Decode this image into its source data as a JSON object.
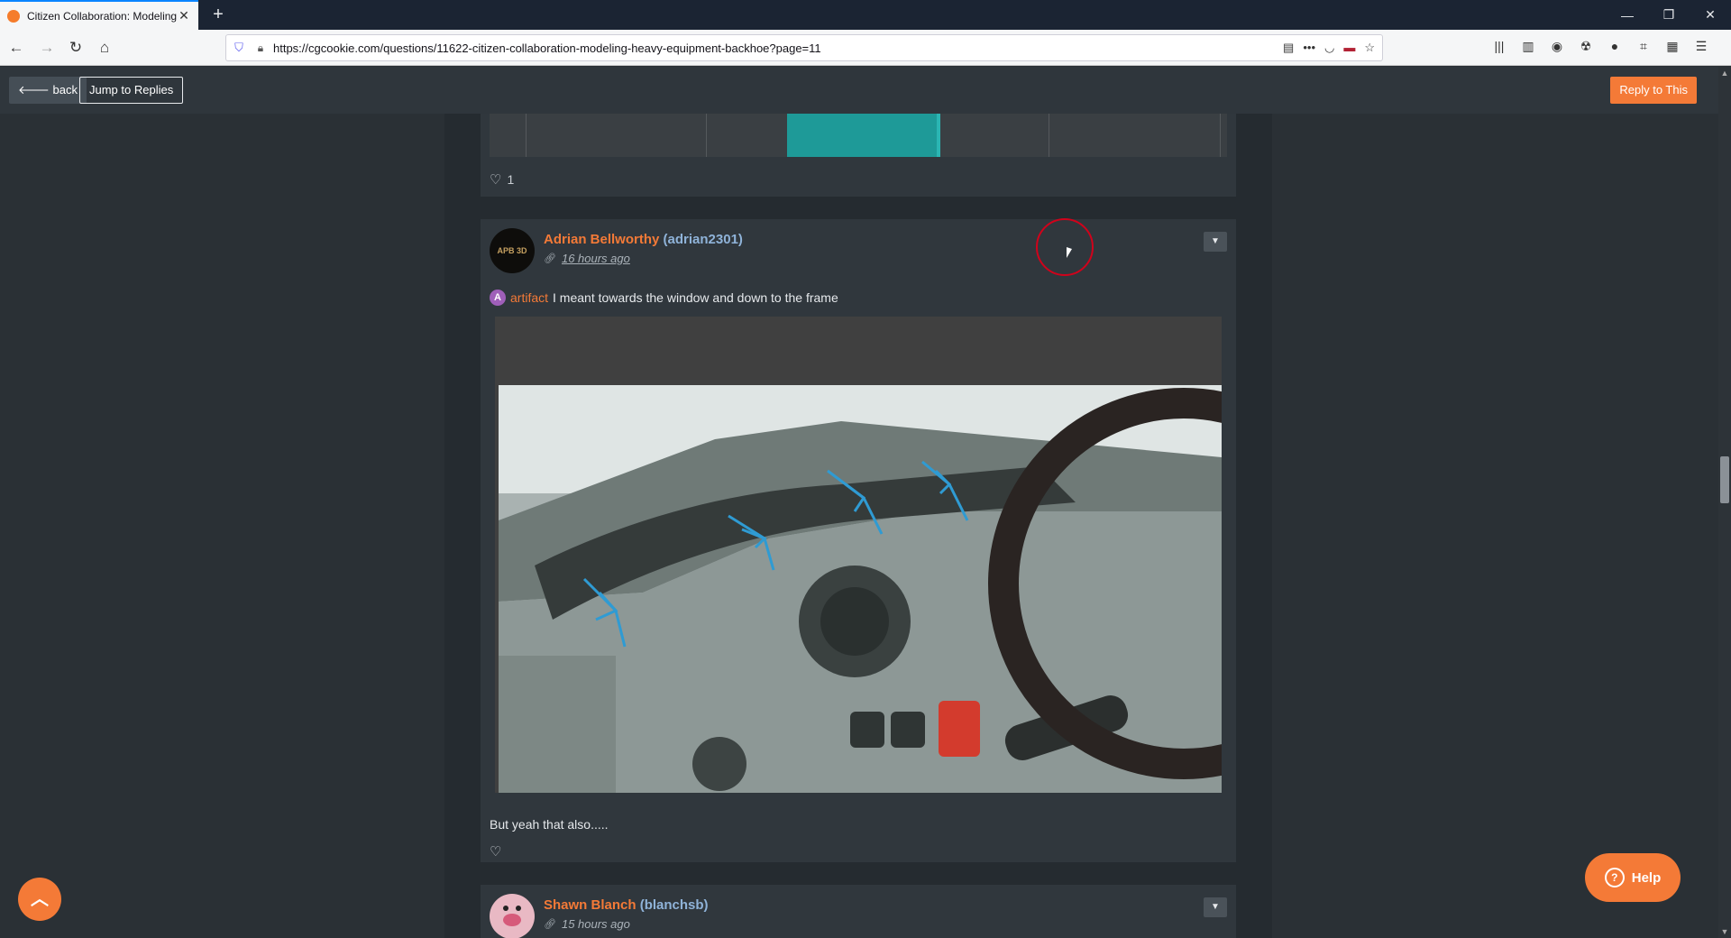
{
  "browser": {
    "tab_title": "Citizen Collaboration: Modeling Heavy Equipment",
    "tab_close": "✕",
    "new_tab": "+",
    "url": "https://cgcookie.com/questions/11622-citizen-collaboration-modeling-heavy-equipment-backhoe?page=11",
    "window": {
      "minimize": "—",
      "restore": "❐",
      "close": "✕"
    }
  },
  "toolbar": {
    "back_label": "back",
    "jump_label": "Jump to Replies",
    "reply_label": "Reply to This"
  },
  "posts": [
    {
      "likes": "1"
    },
    {
      "author_name": "Adrian Bellworthy",
      "author_handle": "(adrian2301)",
      "avatar_text": "APB 3D",
      "time_ago": "16 hours ago",
      "mention_badge": "A",
      "mention": "artifact",
      "text": "I meant towards the window and down to the frame",
      "text2": "But yeah that also.....",
      "likes": ""
    },
    {
      "author_name": "Shawn Blanch",
      "author_handle": "(blanchsb)",
      "time_ago": "15 hours ago"
    }
  ],
  "help_label": "Help",
  "colors": {
    "accent": "#f47a37",
    "handle": "#8fb3d9",
    "page_bg": "#2a3035",
    "card_bg": "#30373d"
  }
}
